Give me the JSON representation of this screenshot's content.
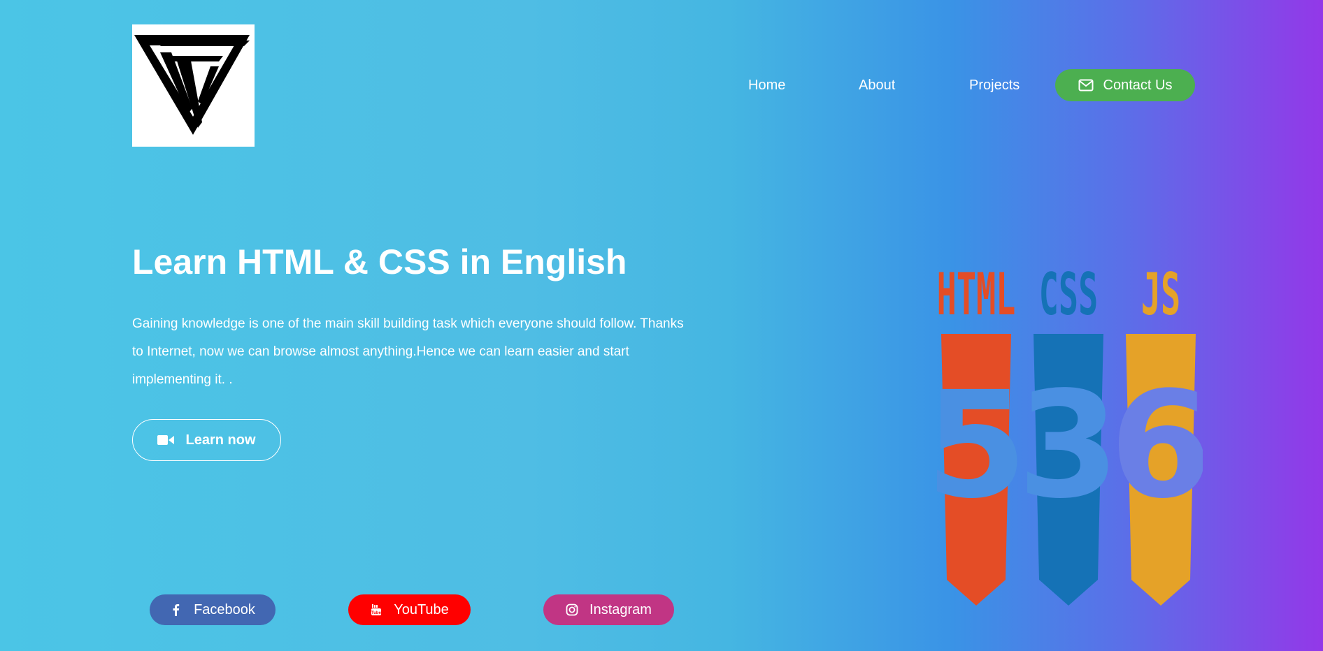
{
  "nav": {
    "home": "Home",
    "about": "About",
    "projects": "Projects",
    "contact": "Contact Us",
    "contact_icon": "envelope-icon"
  },
  "hero": {
    "title": "Learn HTML & CSS in English",
    "description": "Gaining knowledge is one of the main skill building task which everyone should follow. Thanks to Internet, now we can browse almost anything.Hence we can learn easier and start implementing it. .",
    "cta_label": "Learn now",
    "cta_icon": "video-camera-icon"
  },
  "tech_badges": [
    {
      "label": "HTML",
      "number": "5",
      "color": "#e44d26"
    },
    {
      "label": "CSS",
      "number": "3",
      "color": "#1572b6"
    },
    {
      "label": "JS",
      "number": "6",
      "color": "#e5a228"
    }
  ],
  "social": [
    {
      "label": "Facebook",
      "icon": "facebook-icon",
      "color": "#4267b2"
    },
    {
      "label": "YouTube",
      "icon": "youtube-icon",
      "color": "#ff0000"
    },
    {
      "label": "Instagram",
      "icon": "instagram-icon",
      "color": "#c13584"
    }
  ],
  "colors": {
    "gradient_start": "#4bc5e6",
    "gradient_mid": "#3a93e6",
    "gradient_end": "#9338e8",
    "contact_button": "#4caf50"
  }
}
